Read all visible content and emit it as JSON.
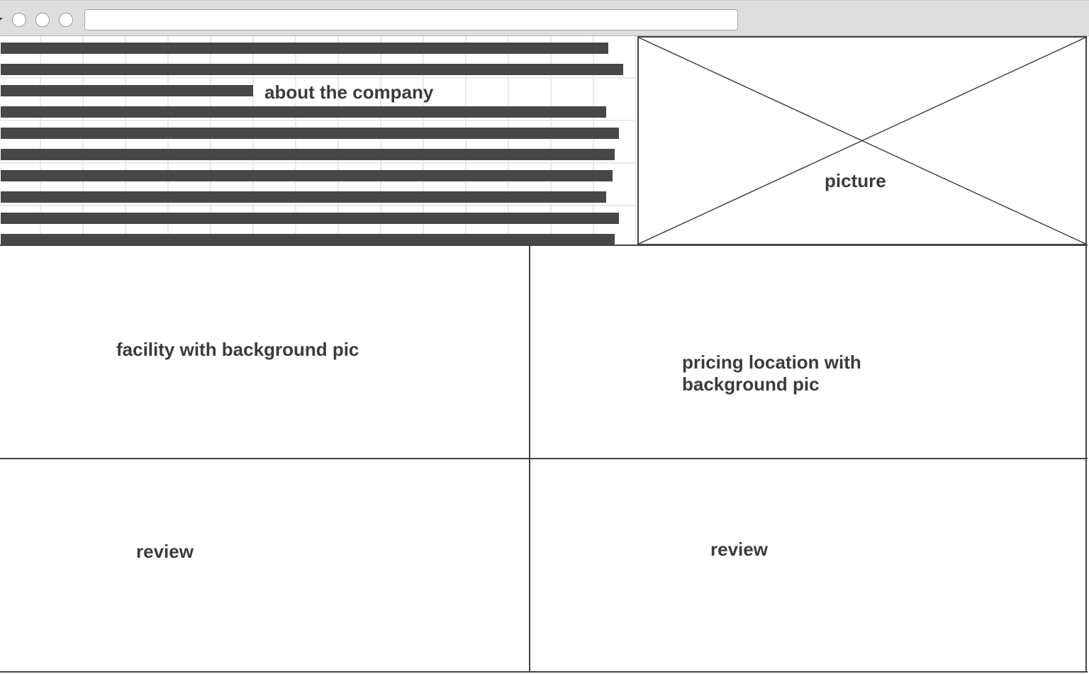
{
  "browser": {
    "url": "",
    "window_buttons": [
      "close-button",
      "minimize-button",
      "maximize-button"
    ]
  },
  "about": {
    "label": "about the company"
  },
  "picture": {
    "label": "picture"
  },
  "facility": {
    "label": "facility with background pic"
  },
  "pricing": {
    "line1": "pricing location with",
    "line2": "background pic"
  },
  "reviews": [
    {
      "label": "review"
    },
    {
      "label": "review"
    }
  ],
  "colors": {
    "line": "#444444",
    "text": "#3b3b3b",
    "chrome": "#dedede"
  }
}
